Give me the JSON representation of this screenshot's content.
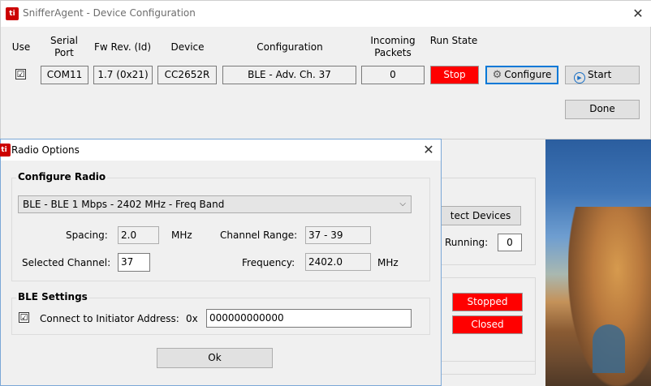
{
  "main_window": {
    "title": "SnifferAgent - Device Configuration",
    "close_glyph": "✕",
    "headers": {
      "use": "Use",
      "serial_port": "Serial Port",
      "fw_rev": "Fw Rev. (Id)",
      "device": "Device",
      "configuration": "Configuration",
      "incoming_packets": "Incoming Packets",
      "run_state": "Run State"
    },
    "row": {
      "use_checked": "☑",
      "serial_port": "COM11",
      "fw_rev": "1.7 (0x21)",
      "device": "CC2652R",
      "configuration": "BLE - Adv. Ch. 37",
      "incoming_packets": "0",
      "run_state": "Stop",
      "configure_label": "Configure",
      "start_label": "Start"
    },
    "done_label": "Done"
  },
  "background_panel": {
    "detect_devices_label": "tect Devices",
    "running_label": "Running:",
    "running_value": "0",
    "status_stopped": "Stopped",
    "status_closed": "Closed"
  },
  "dialog": {
    "title": "Radio Options",
    "close_glyph": "✕",
    "configure_radio": {
      "title": "Configure Radio",
      "band_selected": "BLE - BLE 1 Mbps - 2402 MHz - Freq Band",
      "spacing_label": "Spacing:",
      "spacing_value": "2.0",
      "spacing_unit": "MHz",
      "channel_range_label": "Channel Range:",
      "channel_range_value": "37 - 39",
      "selected_channel_label": "Selected Channel:",
      "selected_channel_value": "37",
      "frequency_label": "Frequency:",
      "frequency_value": "2402.0",
      "frequency_unit": "MHz"
    },
    "ble_settings": {
      "title": "BLE Settings",
      "connect_label": "Connect to Initiator Address:",
      "connect_checked": "☑",
      "prefix": "0x",
      "address_value": "000000000000"
    },
    "ok_label": "Ok"
  },
  "colors": {
    "red_state": "#ff0000",
    "accent_border": "#0078d7"
  },
  "icons": [
    "ti-app-icon",
    "close-icon",
    "gear-icon",
    "play-icon",
    "chevron-down-icon",
    "checkbox-icon"
  ]
}
